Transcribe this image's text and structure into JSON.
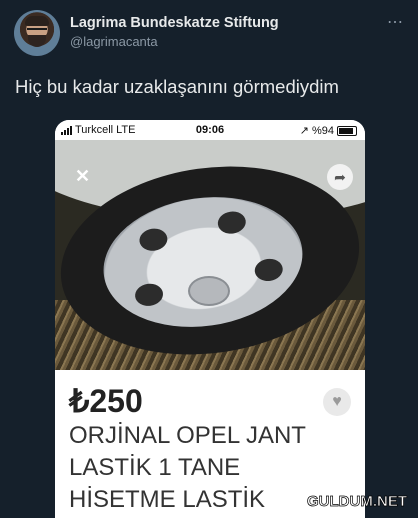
{
  "tweet": {
    "author_name": "Lagrima Bundeskatze Stiftung",
    "author_handle": "@lagrimacanta",
    "more_icon": "⋯",
    "text": "Hiç bu kadar uzaklaşanını görmediydim"
  },
  "phone": {
    "carrier": "Turkcell",
    "network": "LTE",
    "time": "09:06",
    "location_icon": "↗",
    "battery_text": "%94"
  },
  "listing": {
    "close_icon": "✕",
    "share_icon": "➦",
    "price": "₺250",
    "favorite_icon": "♥",
    "title_lines": [
      "ORJİNAL OPEL JANT",
      "LASTİK 1 TANE",
      "HİSETME LASTİK"
    ]
  },
  "watermark": "GULDUM.NET"
}
